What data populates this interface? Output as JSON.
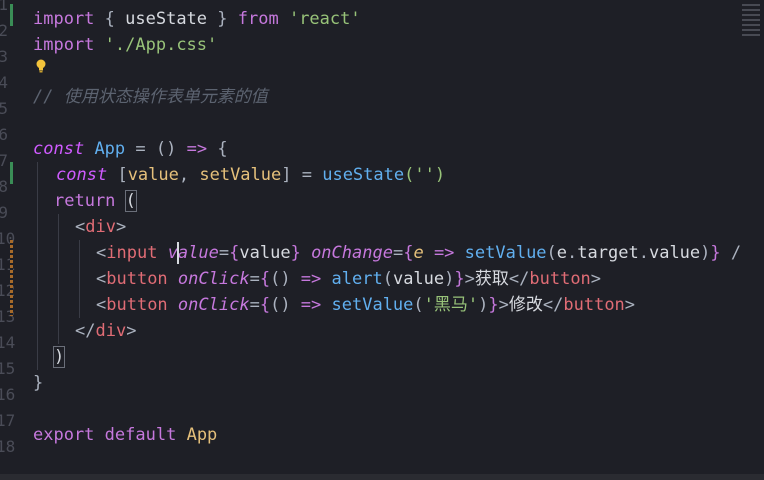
{
  "editor": {
    "line_numbers": [
      "1",
      "2",
      "3",
      "4",
      "5",
      "6",
      "7",
      "8",
      "9",
      "10",
      "11",
      "12",
      "13",
      "14",
      "15",
      "16",
      "17",
      "18"
    ],
    "lines": {
      "l1": {
        "import": "import",
        "open": " { ",
        "name": "useState",
        "close": " } ",
        "from": "from",
        "sp": " ",
        "mod": "'react'"
      },
      "l2": {
        "import": "import",
        "sp": " ",
        "mod": "'./App.css'"
      },
      "l4": {
        "comment": "// 使用状态操作表单元素的值"
      },
      "l6": {
        "const": "const",
        "sp": " ",
        "name": "App",
        "eq": " = ",
        "parens": "()",
        "arrow": " => ",
        "brace": "{"
      },
      "l7": {
        "const": "const",
        "sp": " ",
        "lb": "[",
        "v1": "value",
        "comma": ", ",
        "v2": "setValue",
        "rb": "]",
        "eq": " = ",
        "fn": "useState",
        "arg": "('')"
      },
      "l8": {
        "ret": "return",
        "sp": " ",
        "paren": "("
      },
      "l9": {
        "open": "<",
        "tag": "div",
        "close": ">"
      },
      "l10": {
        "open": "<",
        "tag": "input",
        "sp": " ",
        "attr1": "value",
        "eq1": "=",
        "lb1": "{",
        "v1": "value",
        "rb1": "}",
        "sp2": " ",
        "attr2": "onChange",
        "eq2": "=",
        "lb2": "{",
        "param": "e",
        "arrow": " => ",
        "fn": "setValue",
        "po": "(",
        "obj": "e",
        "dot1": ".",
        "p1": "target",
        "dot2": ".",
        "p2": "value",
        "pc": ")",
        "rb2": "}",
        "tail": " /"
      },
      "l11": {
        "open": "<",
        "tag": "button",
        "sp": " ",
        "attr": "onClick",
        "eq": "=",
        "lb": "{",
        "parens": "()",
        "arrow": " => ",
        "fn": "alert",
        "po": "(",
        "v": "value",
        "pc": ")",
        "rb": "}",
        "gt": ">",
        "text": "获取",
        "close_open": "</",
        "close_tag": "button",
        "close_gt": ">"
      },
      "l12": {
        "open": "<",
        "tag": "button",
        "sp": " ",
        "attr": "onClick",
        "eq": "=",
        "lb": "{",
        "parens": "()",
        "arrow": " => ",
        "fn": "setValue",
        "po": "(",
        "str": "'黑马'",
        "pc": ")",
        "rb": "}",
        "gt": ">",
        "text": "修改",
        "close_open": "</",
        "close_tag": "button",
        "close_gt": ">"
      },
      "l13": {
        "open": "</",
        "tag": "div",
        "close": ">"
      },
      "l14": {
        "paren": ")"
      },
      "l15": {
        "brace": "}"
      },
      "l17": {
        "export": "export",
        "sp": " ",
        "default": "default",
        "sp2": " ",
        "name": "App"
      }
    }
  },
  "colors": {
    "background": "#1e1f26",
    "keyword": "#cf5bff",
    "string": "#98c379",
    "function": "#61afef",
    "tag": "#e06c75",
    "comment": "#5c6370"
  },
  "icons": [
    "lightbulb-icon",
    "minimap"
  ]
}
